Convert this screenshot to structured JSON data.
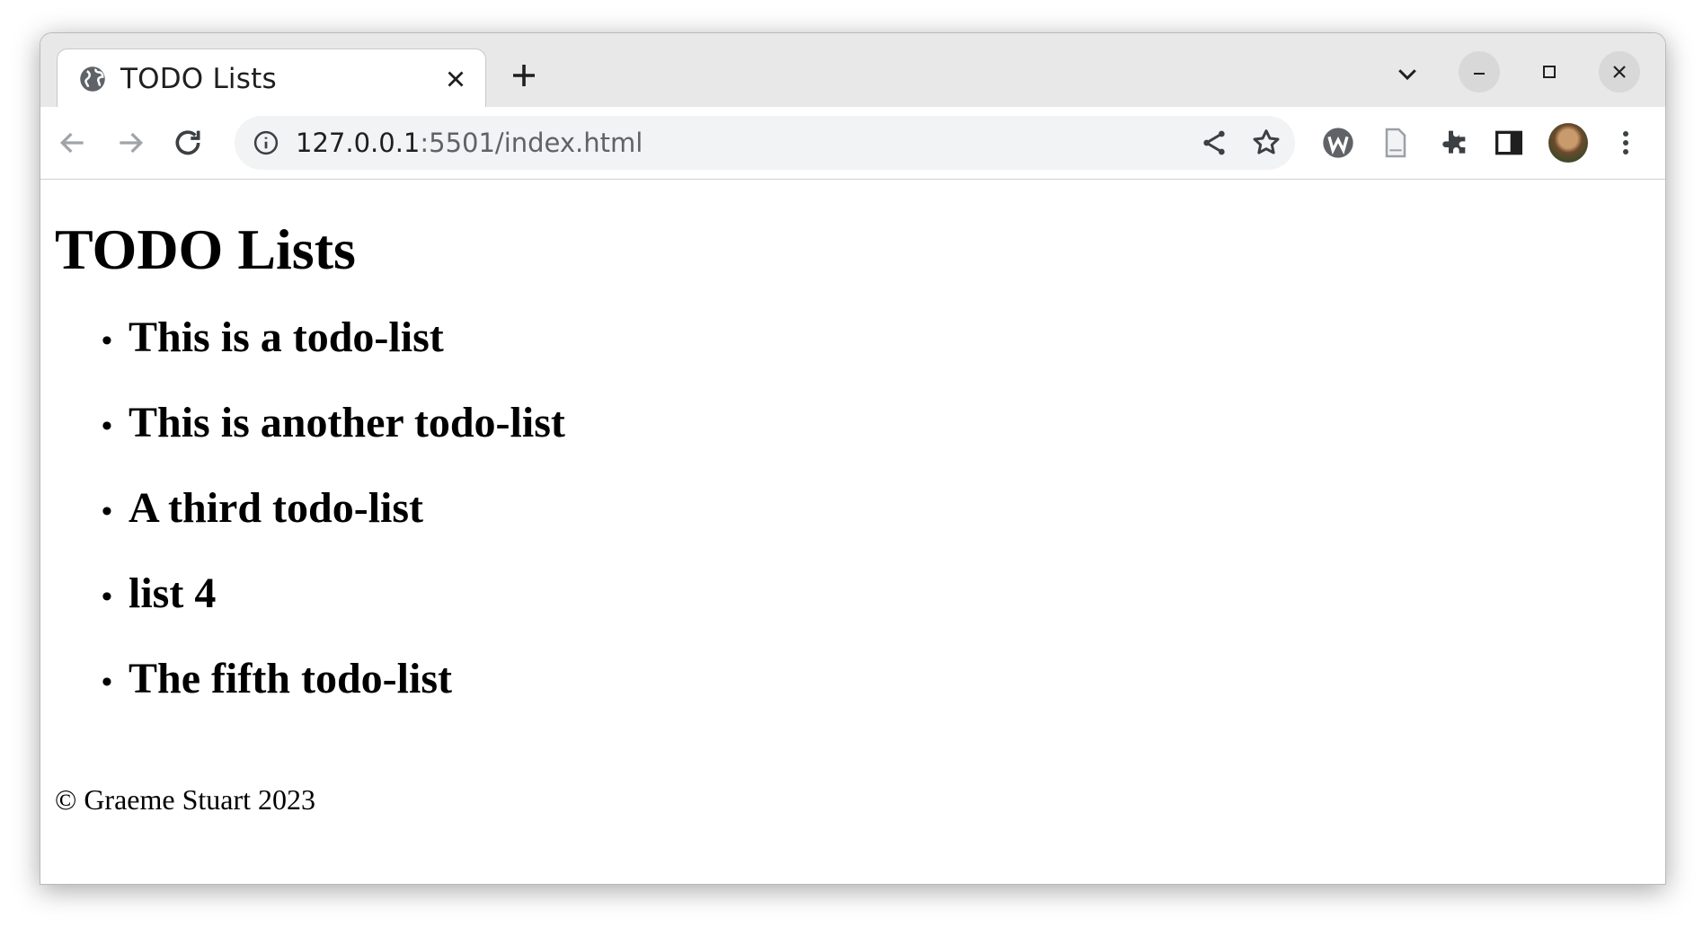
{
  "browser": {
    "tab": {
      "title": "TODO Lists",
      "favicon": "globe-icon"
    },
    "omnibox": {
      "host": "127.0.0.1",
      "path": ":5501/index.html"
    }
  },
  "page": {
    "title": "TODO Lists",
    "lists": [
      {
        "label": "This is a todo-list"
      },
      {
        "label": "This is another todo-list"
      },
      {
        "label": "A third todo-list"
      },
      {
        "label": "list 4"
      },
      {
        "label": "The fifth todo-list"
      }
    ],
    "footer": "© Graeme Stuart 2023"
  },
  "colors": {
    "tabbar_bg": "#e8e8e8",
    "omnibox_bg": "#f1f3f4",
    "icon": "#5f6368",
    "text": "#000000"
  }
}
